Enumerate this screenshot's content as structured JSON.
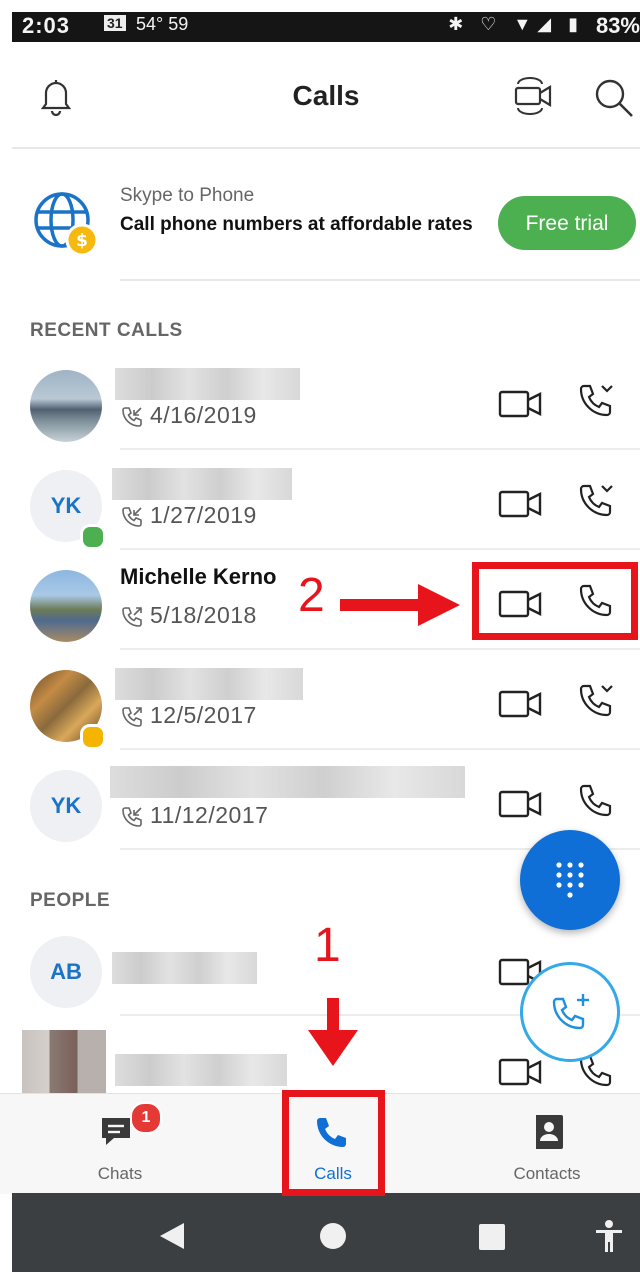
{
  "status": {
    "time": "2:03",
    "calendar": "31",
    "temp": "54° 59",
    "battery": "83%"
  },
  "header": {
    "title": "Calls"
  },
  "promo": {
    "subtitle": "Skype to Phone",
    "text": "Call phone numbers at affordable rates",
    "button": "Free trial"
  },
  "recent": {
    "heading": "RECENT CALLS",
    "calls": [
      {
        "name": "",
        "date": "4/16/2019"
      },
      {
        "name": "",
        "initials": "YK",
        "date": "1/27/2019"
      },
      {
        "name": "Michelle Kerno",
        "date": "5/18/2018"
      },
      {
        "name": "",
        "date": "12/5/2017"
      },
      {
        "name": "",
        "initials": "YK",
        "date": "11/12/2017"
      }
    ]
  },
  "people": {
    "heading": "PEOPLE",
    "items": [
      {
        "initials": "AB"
      }
    ]
  },
  "nav": {
    "chats": "Chats",
    "chats_badge": "1",
    "calls": "Calls",
    "contacts": "Contacts"
  },
  "annotations": {
    "step1": "1",
    "step2": "2"
  },
  "colors": {
    "accent": "#0f6fd6",
    "trial": "#4caf50",
    "annotation": "#e8141c"
  }
}
